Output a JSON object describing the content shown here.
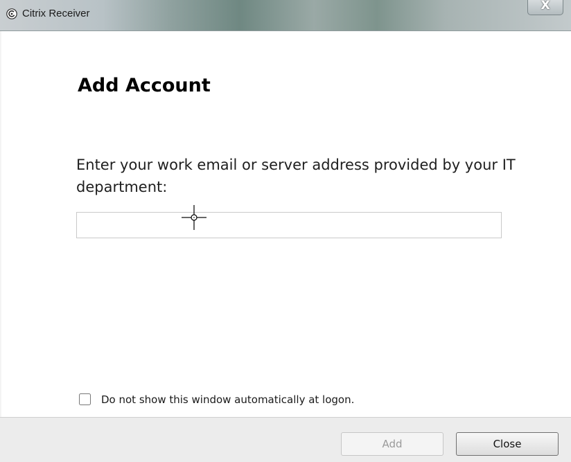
{
  "window": {
    "title": "Citrix Receiver",
    "close_glyph": "X"
  },
  "dialog": {
    "heading": "Add Account",
    "prompt": "Enter your work email or server address provided by your IT department:",
    "address_input": {
      "value": "",
      "placeholder": ""
    }
  },
  "option": {
    "checkbox_label": "Do not show this window automatically at logon.",
    "checked": false
  },
  "buttons": {
    "add_label": "Add",
    "add_enabled": false,
    "close_label": "Close"
  },
  "icons": {
    "app": "citrix-receiver-icon",
    "pointer": "crosshair-cursor-icon"
  }
}
